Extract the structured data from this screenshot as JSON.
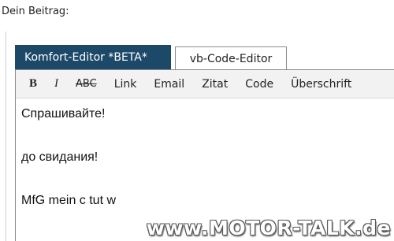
{
  "form": {
    "label": "Dein Beitrag:"
  },
  "tabs": [
    {
      "label": "Komfort-Editor *BETA*",
      "active": true
    },
    {
      "label": "vb-Code-Editor",
      "active": false
    }
  ],
  "toolbar": {
    "bold": "B",
    "italic": "I",
    "strike": "ABC",
    "link": "Link",
    "email": "Email",
    "quote": "Zitat",
    "code": "Code",
    "heading": "Überschrift"
  },
  "editor": {
    "lines": [
      "Спрашивайте!",
      "до свидания!",
      "MfG mein c tut w"
    ]
  },
  "watermark": "www.MOTOR-TALK.de",
  "colors": {
    "active_tab": "#1d4969",
    "toolbar_bg": "#f2f2f2"
  }
}
